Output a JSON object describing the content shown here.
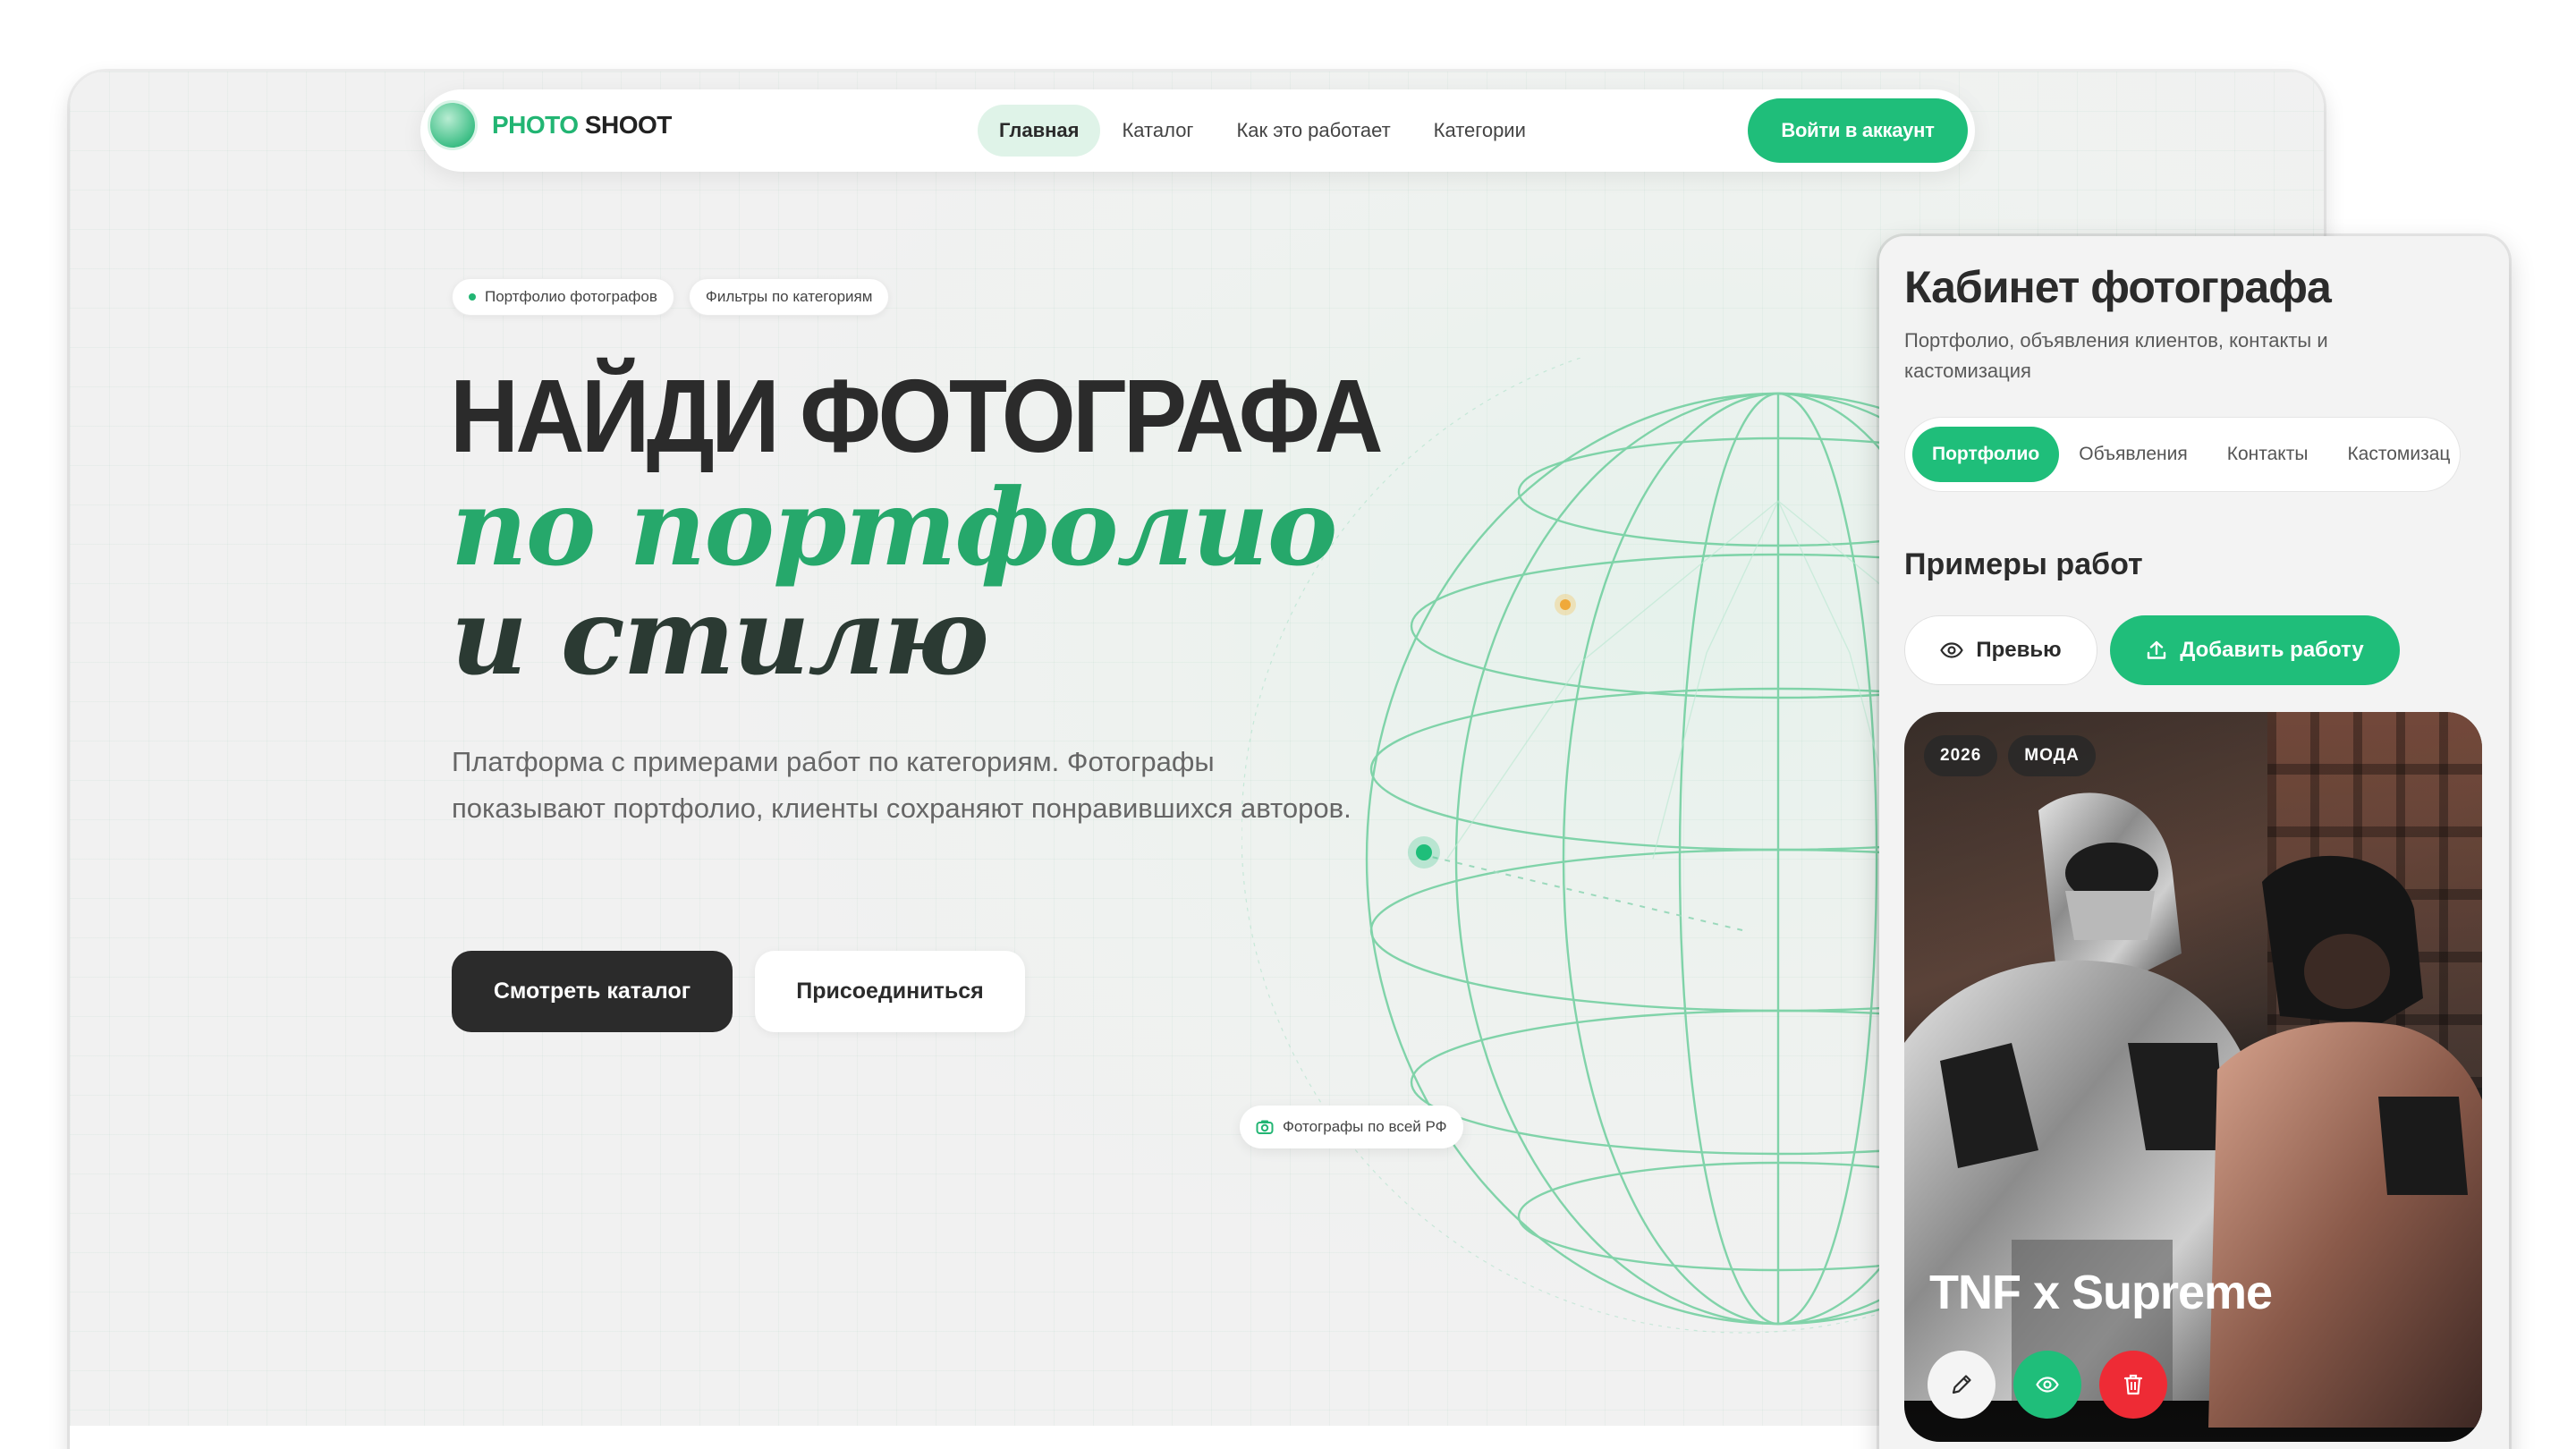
{
  "logo": {
    "accent": "PHOTO",
    "rest": " SHOOT"
  },
  "nav": {
    "items": [
      "Главная",
      "Каталог",
      "Как это работает",
      "Категории"
    ],
    "active_index": 0,
    "login_label": "Войти в аккаунт"
  },
  "hero": {
    "chips": [
      "Портфолио фотографов",
      "Фильтры по категориям"
    ],
    "title_line1": "НАЙДИ ФОТОГРАФА",
    "title_line2": "по портфолио",
    "title_line3": "и стилю",
    "description": "Платформа с примерами работ по категориям. Фотографы показывают портфолио, клиенты сохраняют понравившихся авторов.",
    "primary_button": "Смотреть каталог",
    "secondary_button": "Присоединиться",
    "globe_badge": "Фотографы по всей РФ"
  },
  "panel": {
    "title": "Кабинет фотографа",
    "subtitle": "Портфолио, объявления клиентов, контакты и кастомизация",
    "tabs": [
      "Портфолио",
      "Объявления",
      "Контакты",
      "Кастомизац"
    ],
    "active_tab_index": 0,
    "section_title": "Примеры работ",
    "preview_button": "Превью",
    "add_button": "Добавить работу",
    "card": {
      "tags": [
        "2026",
        "МОДА"
      ],
      "title": "TNF x Supreme"
    }
  },
  "colors": {
    "accent": "#1fbe7a",
    "dark": "#2b2b2b",
    "danger": "#ee2b35"
  },
  "icons": {
    "logo": "camera-globe-logo",
    "badge": "camera-icon",
    "preview": "eye-icon",
    "add": "upload-icon",
    "edit": "pencil-icon",
    "view": "eye-icon",
    "delete": "trash-icon"
  }
}
